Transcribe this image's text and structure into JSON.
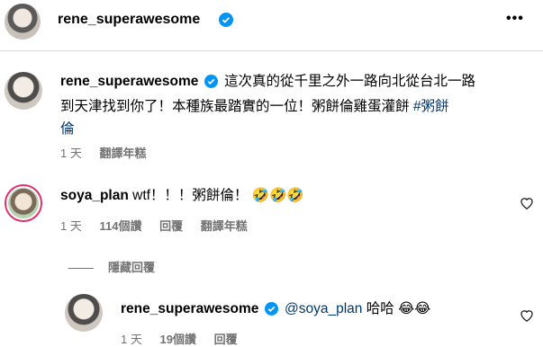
{
  "header": {
    "username": "rene_superawesome",
    "more_label": "•••"
  },
  "caption": {
    "username": "rene_superawesome",
    "text_line1": "這次真的從千里之外一路向北從台北一路",
    "text_line2": "到天津找到你了！本種族最踏實的一位！粥餅倫雞蛋灌餅",
    "hashtag_part1": "#粥餅",
    "hashtag_part2": "倫",
    "time": "1 天",
    "translate": "翻譯年糕"
  },
  "comments": [
    {
      "username": "soya_plan",
      "text": "wtf！！！粥餅倫！",
      "emoji": "🤣🤣🤣",
      "time": "1 天",
      "likes": "114個讚",
      "reply": "回覆",
      "translate": "翻譯年糕"
    }
  ],
  "replies_toggle": {
    "label": "隱藏回覆"
  },
  "reply": {
    "username": "rene_superawesome",
    "mention": "@soya_plan",
    "text": "哈哈",
    "emoji": "😂😂",
    "time": "1 天",
    "likes": "19個讚",
    "reply": "回覆"
  },
  "icons": {
    "verified": "verified-badge-icon",
    "heart": "heart-outline-icon",
    "more": "more-options-icon"
  },
  "colors": {
    "verified": "#0095f6",
    "hashtag": "#00376b",
    "meta": "#737373"
  }
}
